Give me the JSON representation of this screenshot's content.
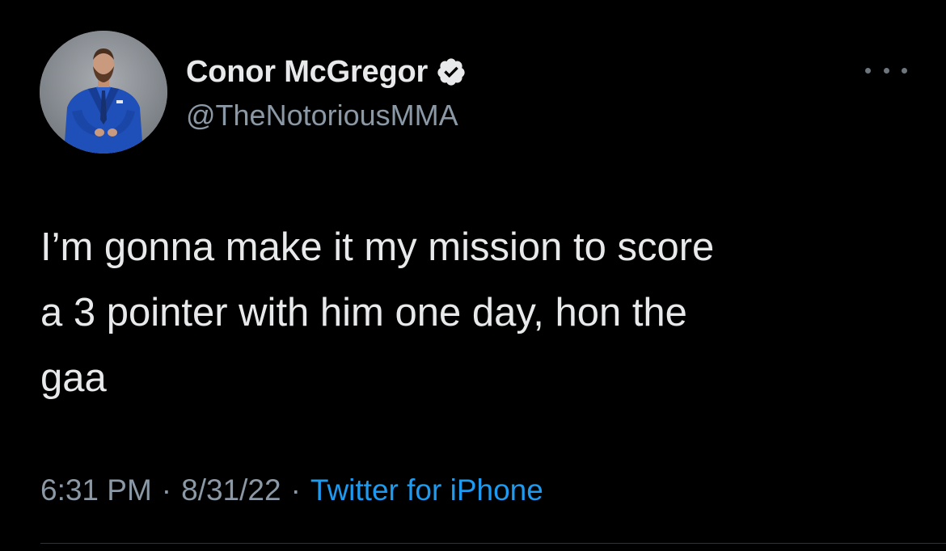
{
  "author": {
    "display_name": "Conor McGregor",
    "handle": "@TheNotoriousMMA",
    "verified": true,
    "avatar_icon": "profile-photo-man-in-blue-suit"
  },
  "more_menu_icon": "more-horizontal-icon",
  "tweet": {
    "lines": [
      "I’m gonna make it my mission to score",
      "a 3 pointer with him one day, hon the",
      "gaa"
    ]
  },
  "meta": {
    "time": "6:31 PM",
    "date": "8/31/22",
    "separator": "·",
    "source": "Twitter for iPhone"
  },
  "colors": {
    "background": "#000000",
    "primary_text": "#e7e9ea",
    "secondary_text": "#8b98a5",
    "link": "#1d9bf0",
    "verified_badge": "#e7e9ea"
  }
}
